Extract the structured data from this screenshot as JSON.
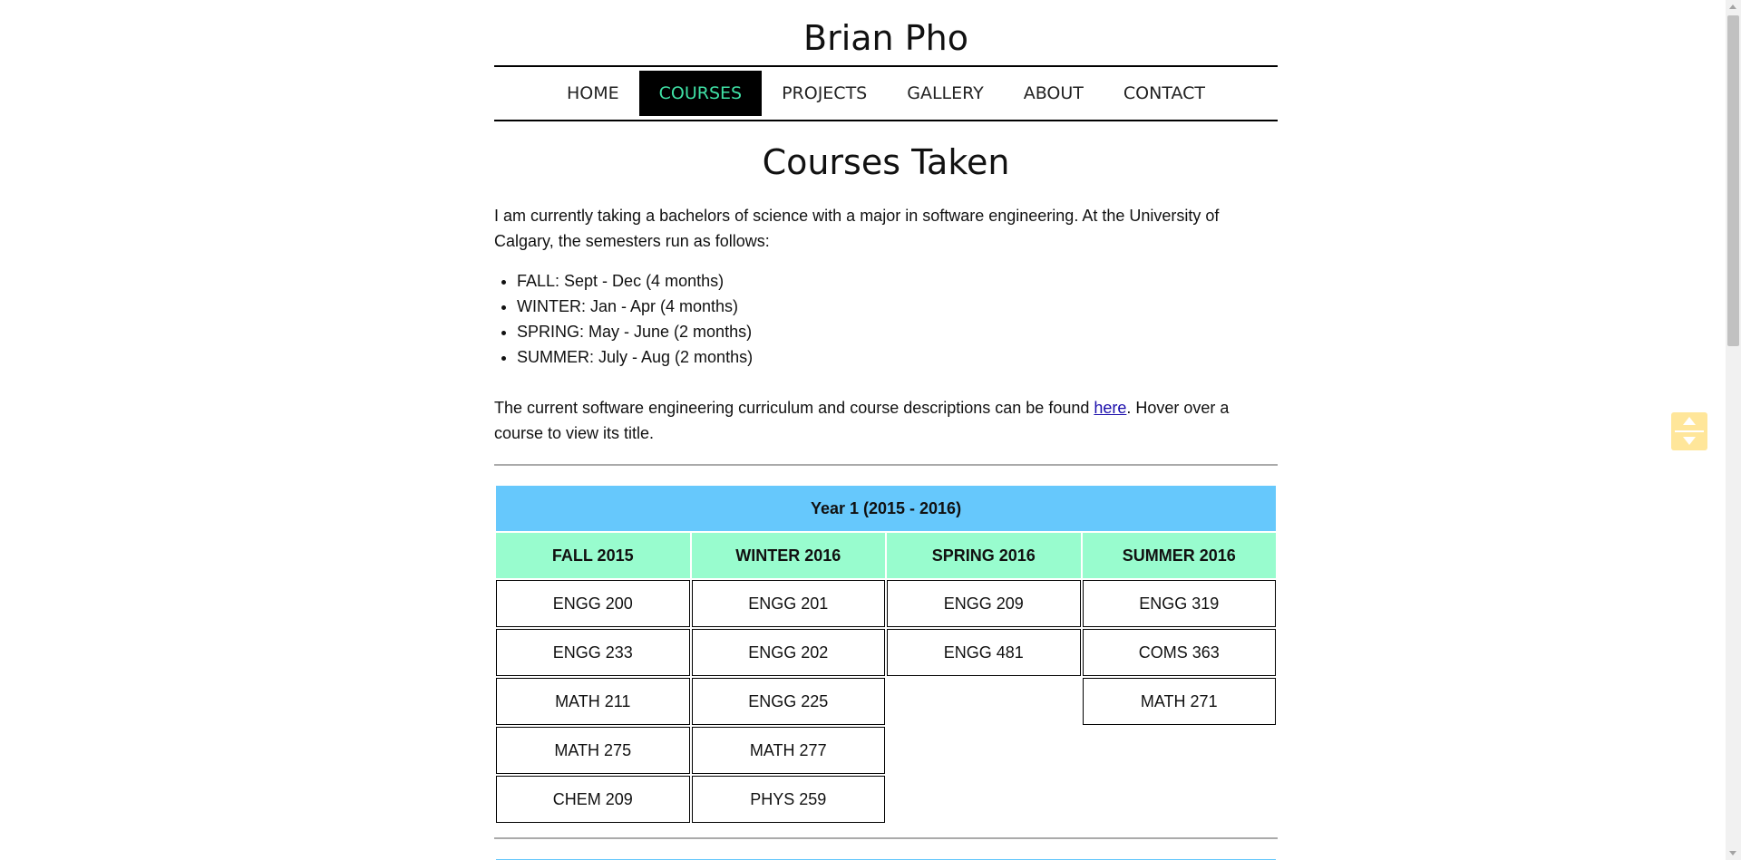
{
  "site": {
    "title": "Brian Pho"
  },
  "nav": {
    "items": [
      {
        "label": "HOME"
      },
      {
        "label": "COURSES"
      },
      {
        "label": "PROJECTS"
      },
      {
        "label": "GALLERY"
      },
      {
        "label": "ABOUT"
      },
      {
        "label": "CONTACT"
      }
    ],
    "active": "COURSES"
  },
  "main": {
    "heading": "Courses Taken",
    "intro": "I am currently taking a bachelors of science with a major in software engineering. At the University of Calgary, the semesters run as follows:",
    "semesters": [
      "FALL: Sept - Dec (4 months)",
      "WINTER: Jan - Apr (4 months)",
      "SPRING: May - June (2 months)",
      "SUMMER: July - Aug (2 months)"
    ],
    "curriculum_before": "The current software engineering curriculum and course descriptions can be found ",
    "curriculum_link": "here",
    "curriculum_after": ". Hover over a course to view its title."
  },
  "year1": {
    "title": "Year 1 (2015 - 2016)",
    "terms": [
      "FALL 2015",
      "WINTER 2016",
      "SPRING 2016",
      "SUMMER 2016"
    ],
    "rows": [
      [
        "ENGG 200",
        "ENGG 201",
        "ENGG 209",
        "ENGG 319"
      ],
      [
        "ENGG 233",
        "ENGG 202",
        "ENGG 481",
        "COMS 363"
      ],
      [
        "MATH 211",
        "ENGG 225",
        "",
        "MATH 271"
      ],
      [
        "MATH 275",
        "MATH 277",
        "",
        ""
      ],
      [
        "CHEM 209",
        "PHYS 259",
        "",
        ""
      ]
    ]
  },
  "colors": {
    "year_header": "#66c8fc",
    "term_header": "#98fcce",
    "nav_active_bg": "#000000",
    "nav_active_text": "#3fe0a5",
    "scroll_widget": "#ffe69a"
  },
  "icons": {
    "scroll_widget": "scroll-up-down-icon"
  }
}
